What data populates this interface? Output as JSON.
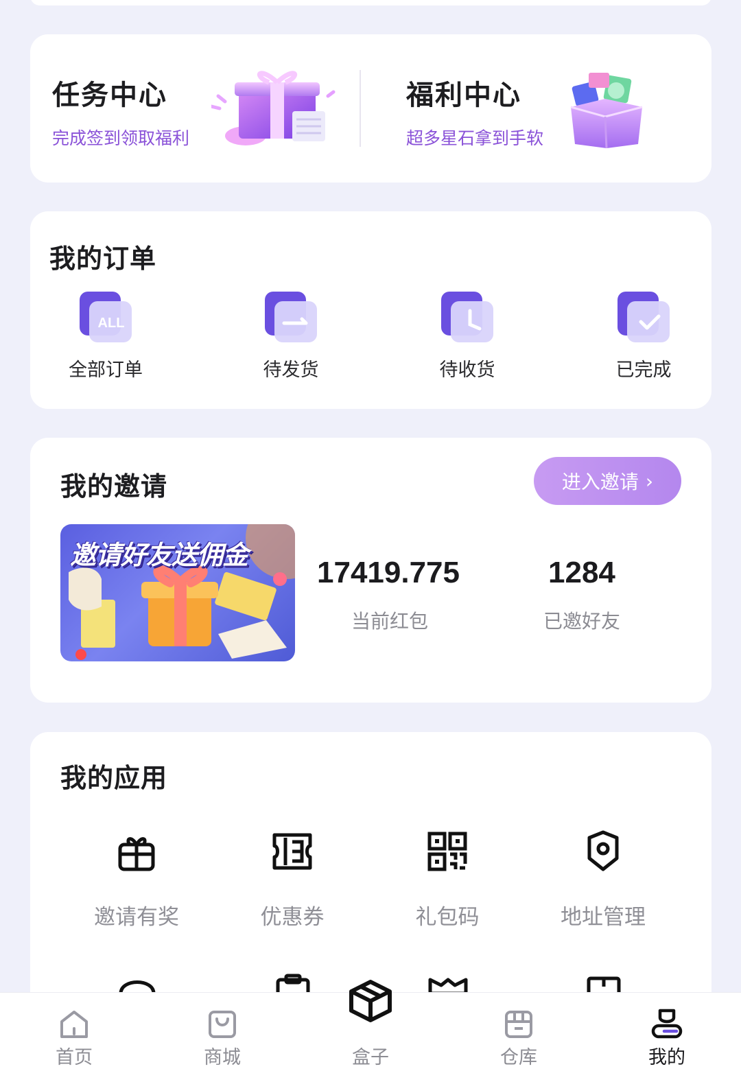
{
  "centers": {
    "task": {
      "title": "任务中心",
      "subtitle": "完成签到领取福利"
    },
    "welfare": {
      "title": "福利中心",
      "subtitle": "超多星石拿到手软"
    }
  },
  "orders": {
    "title": "我的订单",
    "items": [
      {
        "label": "全部订单",
        "icon": "all-orders-icon",
        "badge": "ALL"
      },
      {
        "label": "待发货",
        "icon": "pending-shipment-icon"
      },
      {
        "label": "待收货",
        "icon": "pending-receipt-icon"
      },
      {
        "label": "已完成",
        "icon": "completed-icon"
      }
    ]
  },
  "invite": {
    "title": "我的邀请",
    "button_label": "进入邀请",
    "banner_text": "邀请好友送佣金",
    "stats": [
      {
        "value": "17419.775",
        "label": "当前红包"
      },
      {
        "value": "1284",
        "label": "已邀好友"
      }
    ]
  },
  "apps": {
    "title": "我的应用",
    "items": [
      {
        "label": "邀请有奖",
        "icon": "gift-icon"
      },
      {
        "label": "优惠券",
        "icon": "coupon-icon"
      },
      {
        "label": "礼包码",
        "icon": "qr-code-icon"
      },
      {
        "label": "地址管理",
        "icon": "location-icon"
      }
    ]
  },
  "tabbar": {
    "items": [
      {
        "label": "首页",
        "icon": "home-icon"
      },
      {
        "label": "商城",
        "icon": "shop-icon"
      },
      {
        "label": "盒子",
        "icon": "box-icon"
      },
      {
        "label": "仓库",
        "icon": "warehouse-icon"
      },
      {
        "label": "我的",
        "icon": "profile-icon"
      }
    ],
    "active": "我的"
  },
  "colors": {
    "accent": "#8a52d8",
    "button": "#c08ff0",
    "background": "#eff0fa"
  }
}
